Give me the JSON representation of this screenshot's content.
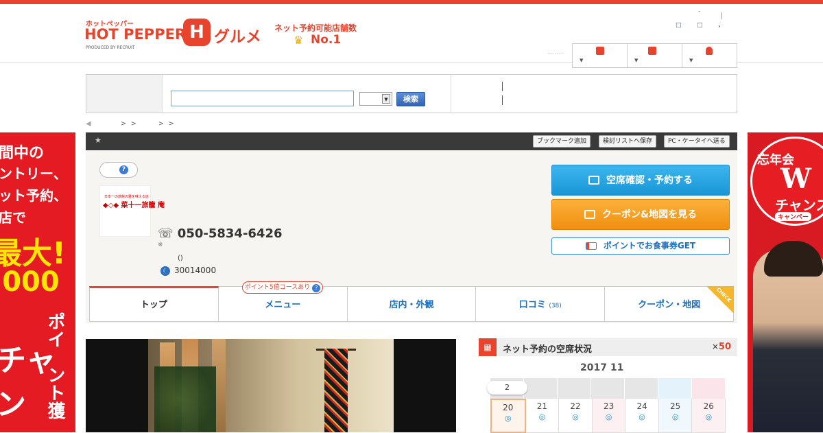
{
  "header": {
    "logo_small": "ホットペッパー",
    "logo_main": "HOT PEPPER",
    "logo_h": "H",
    "logo_gourmet": "グルメ",
    "logo_produced": "PRODUCED BY RECRUIT",
    "no1_label": "ネット予約可能店舗数",
    "no1": "No.1",
    "dash": "-",
    "link1": "□",
    "link2": "□",
    "link3": "›",
    "dots": "⋯⋯⋯"
  },
  "search": {
    "button": "検索",
    "input_value": ""
  },
  "breadcrumb": {
    "back": "◀",
    "text": ">  >          >  >"
  },
  "shop_bar": {
    "star": "★",
    "bookmark": "ブックマーク追加",
    "list": "検討リストへ保存",
    "send": "PC・ケータイへ送る"
  },
  "shop": {
    "help": "?",
    "logo_line1": "日本一の旅館の雅を味える店",
    "logo_line2": "◆◇◆ 菜十一旅籠 庵",
    "phone": "050-5834-6426",
    "phone_icon": "☏",
    "note": "※",
    "paren": "()",
    "budget_icon": "☾",
    "budget": "30014000"
  },
  "cta": {
    "reserve": "空席確認・予約する",
    "coupon": "クーポン&地図を見る",
    "point": "ポイントでお食事券GET"
  },
  "tabs": {
    "badge": "ポイント5倍コースあり",
    "badge_help": "?",
    "top": "トップ",
    "menu": "メニュー",
    "interior": "店内・外観",
    "reviews": "口コミ",
    "reviews_count": "(38)",
    "coupon": "クーポン・地図",
    "check": "CHECK"
  },
  "availability": {
    "title": "ネット予約の空席状況",
    "mult_prefix": "×",
    "mult": "50",
    "month": "2017 11",
    "today_flag": "2",
    "days": [
      {
        "d": "20",
        "m": "◎"
      },
      {
        "d": "21",
        "m": "◎"
      },
      {
        "d": "22",
        "m": "◎"
      },
      {
        "d": "23",
        "m": "◎"
      },
      {
        "d": "24",
        "m": "◎"
      },
      {
        "d": "25",
        "m": "◎"
      },
      {
        "d": "26",
        "m": "◎"
      }
    ]
  },
  "ad_left": {
    "l1": "間中の",
    "l2": "ントリー、",
    "l3": "ット予約、",
    "l4": "店で",
    "l5": "最大!",
    "l6": ",000",
    "l7": "ポイ",
    "l8": "チャ",
    "l9": "ント獲",
    "l10": "ン"
  },
  "ad_right": {
    "t1": "忘年会",
    "t2": "W",
    "t3": "チャンス",
    "t4": "キャンペー"
  },
  "colors": {
    "accent": "#e8432d",
    "link": "#1a6fc0",
    "reserve": "#1a96d6",
    "coupon": "#f08f10"
  }
}
